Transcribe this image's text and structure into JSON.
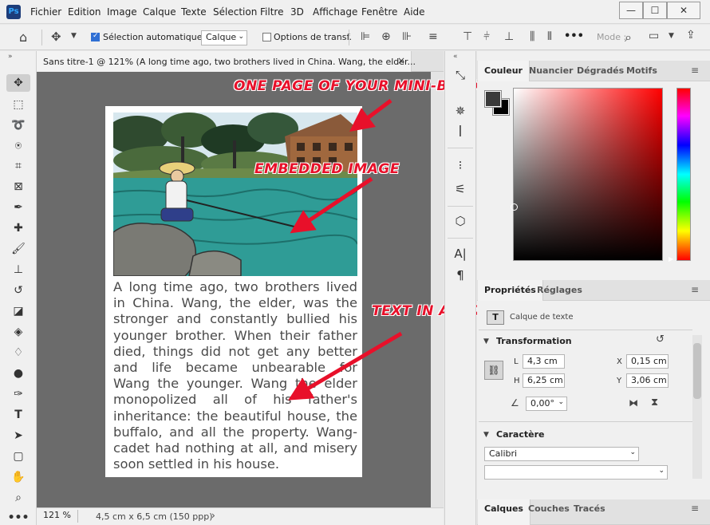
{
  "menu": {
    "app_icon": "Ps",
    "items": [
      "Fichier",
      "Edition",
      "Image",
      "Calque",
      "Texte",
      "Sélection",
      "Filtre",
      "3D",
      "Affichage",
      "Fenêtre",
      "Aide"
    ],
    "window_controls": [
      "minimize",
      "restore",
      "close"
    ]
  },
  "options_bar": {
    "auto_select_label": "Sélection automatique :",
    "auto_select_checked": true,
    "layer_select_value": "Calque",
    "transform_options_label": "Options de transf.",
    "transform_options_checked": false,
    "more_label": "•••",
    "mode_label": "Mode :"
  },
  "document": {
    "tab_title": "Sans titre-1 @ 121% (A long time ago, two brothers lived in China. Wang, the elder...",
    "close_glyph": "×",
    "zoom": "121 %",
    "size_info": "4,5 cm x 6,5 cm (150 ppp)",
    "story_text": "A long time ago, two brothers lived in China. Wang, the elder, was the stronger and constantly bullied his younger brother. When their father died, things did not get any better and life became unbearable for Wang the younger. Wang the elder monopolized all of his father's inheritance: the beautiful house, the buffalo, and all the property. Wang-cadet had nothing at all, and misery soon settled in his house."
  },
  "annotations": {
    "page_label": "ONE PAGE OF YOUR MINI-BOOK",
    "image_label": "EMBEDDED IMAGE",
    "text_label": "TEXT IN A TEXT BOX",
    "arrow_color": "#e8102a"
  },
  "color_panel": {
    "tabs": [
      "Couleur",
      "Nuancier",
      "Dégradés",
      "Motifs"
    ],
    "foreground_color": "#3a3a3a",
    "background_color": "#000000"
  },
  "properties_panel": {
    "tabs": [
      "Propriétés",
      "Réglages"
    ],
    "layer_type": "Calque de texte",
    "transform_title": "Transformation",
    "fields": {
      "L": "4,3 cm",
      "X": "0,15 cm",
      "H": "6,25 cm",
      "Y": "3,06 cm",
      "angle": "0,00°"
    },
    "character_title": "Caractère",
    "font_family": "Calibri",
    "font_style": ""
  },
  "bottom_panel": {
    "tabs": [
      "Calques",
      "Couches",
      "Tracés"
    ]
  }
}
